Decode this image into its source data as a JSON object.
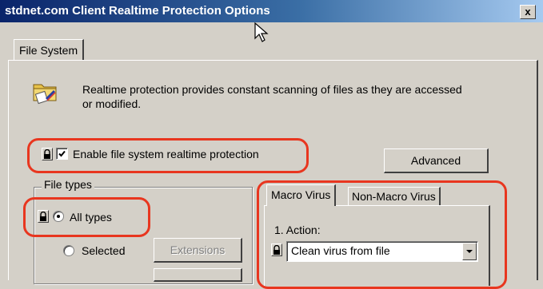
{
  "window": {
    "title": "stdnet.com Client Realtime Protection Options",
    "close_label": "x"
  },
  "tabs": {
    "file_system": "File System"
  },
  "description": "Realtime protection provides constant scanning of files as they are accessed or modified.",
  "enable": {
    "label": "Enable file system realtime protection",
    "checked": true
  },
  "advanced_button": "Advanced",
  "file_types": {
    "group_title": "File types",
    "all_types": "All types",
    "selected": "Selected",
    "extensions_button": "Extensions",
    "selected_option": "All types"
  },
  "virus_tabs": {
    "macro": "Macro Virus",
    "non_macro": "Non-Macro Virus"
  },
  "action": {
    "label": "1. Action:",
    "value": "Clean virus from file"
  },
  "colors": {
    "highlight_ring": "#e8361f",
    "titlebar_start": "#0a246a",
    "titlebar_end": "#a6caf0",
    "dialog_bg": "#d4d0c8"
  }
}
